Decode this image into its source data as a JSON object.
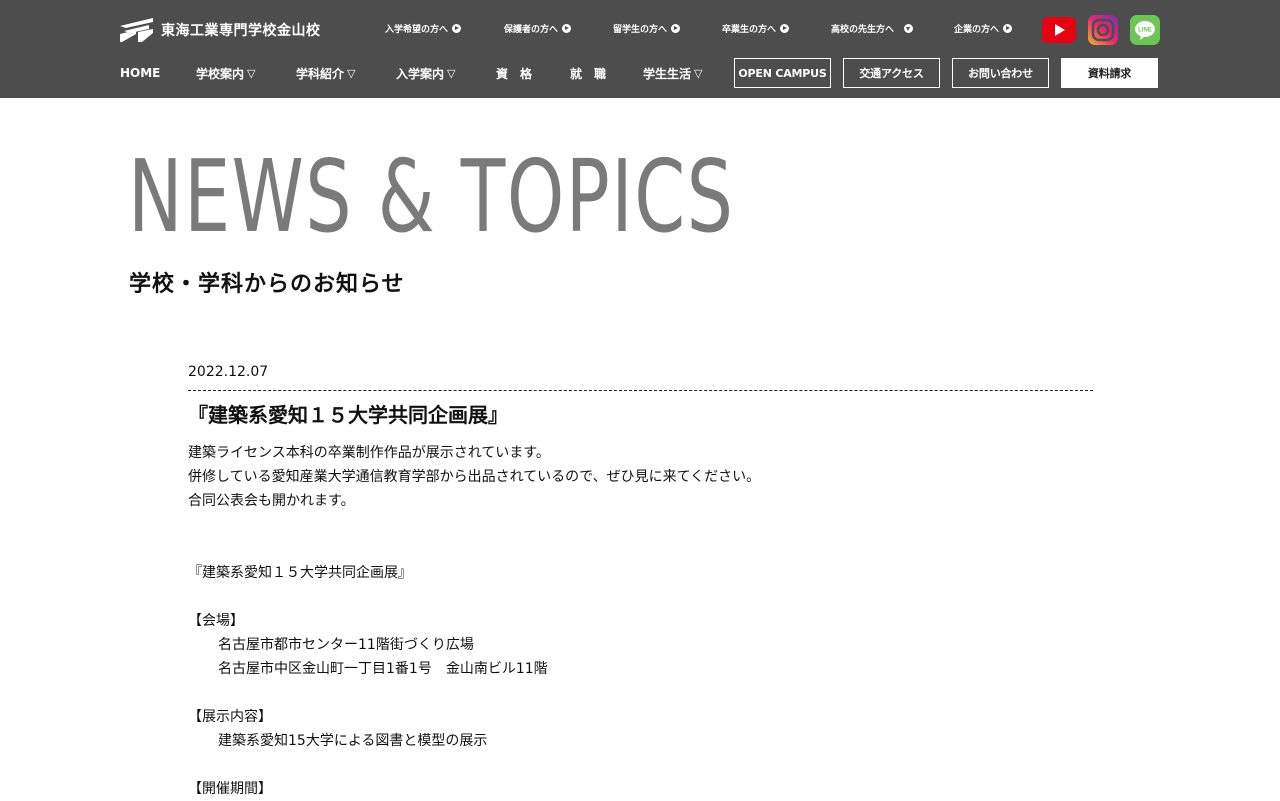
{
  "header": {
    "logo_text": "東海工業専門学校金山校",
    "top_links": [
      {
        "label": "入学希望の方へ",
        "arrow": "right"
      },
      {
        "label": "保護者の方へ",
        "arrow": "right"
      },
      {
        "label": "留学生の方へ",
        "arrow": "right"
      },
      {
        "label": "卒業生の方へ",
        "arrow": "right"
      },
      {
        "label": "高校の先生方へ",
        "arrow": "down"
      },
      {
        "label": "企業の方へ",
        "arrow": "right"
      }
    ],
    "social": {
      "youtube": "youtube-icon",
      "instagram": "instagram-icon",
      "line": "line-icon",
      "line_text": "LINE"
    },
    "nav": [
      {
        "label": "HOME",
        "caret": ""
      },
      {
        "label": "学校案内",
        "caret": "▽"
      },
      {
        "label": "学科紹介",
        "caret": "▽"
      },
      {
        "label": "入学案内",
        "caret": "▽"
      },
      {
        "label": "資　格",
        "caret": ""
      },
      {
        "label": "就　職",
        "caret": ""
      },
      {
        "label": "学生生活",
        "caret": "▽"
      }
    ],
    "buttons": {
      "open_campus": "OPEN CAMPUS",
      "access": "交通アクセス",
      "contact": "お問い合わせ",
      "request": "資料請求"
    },
    "colors": {
      "header_bg": "#4d4d4d",
      "youtube": "#e60012",
      "line": "#6cc655"
    }
  },
  "page": {
    "title": "NEWS & TOPICS",
    "subtitle": "学校・学科からのお知らせ"
  },
  "article": {
    "date": "2022.12.07",
    "title": "『建築系愛知１５大学共同企画展』",
    "lines": [
      {
        "text": "建築ライセンス本科の卒業制作作品が展示されています。",
        "indent": false
      },
      {
        "text": "併修している愛知産業大学通信教育学部から出品されているので、ぜひ見に来てください。",
        "indent": false
      },
      {
        "text": "合同公表会も開かれます。",
        "indent": false
      },
      {
        "text": "",
        "indent": false
      },
      {
        "text": "",
        "indent": false
      },
      {
        "text": "『建築系愛知１５大学共同企画展』",
        "indent": false
      },
      {
        "text": "",
        "indent": false
      },
      {
        "text": "【会場】",
        "indent": false
      },
      {
        "text": "名古屋市都市センター11階街づくり広場",
        "indent": true
      },
      {
        "text": "名古屋市中区金山町一丁目1番1号　金山南ビル11階",
        "indent": true
      },
      {
        "text": "",
        "indent": false
      },
      {
        "text": "【展示内容】",
        "indent": false
      },
      {
        "text": "建築系愛知15大学による図書と模型の展示",
        "indent": true
      },
      {
        "text": "",
        "indent": false
      },
      {
        "text": "【開催期間】",
        "indent": false
      }
    ]
  }
}
